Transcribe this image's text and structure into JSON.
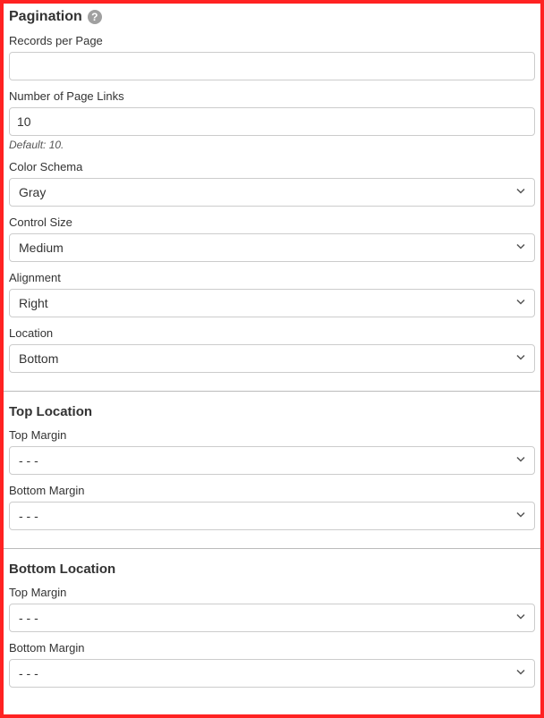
{
  "pagination": {
    "title": "Pagination",
    "records_per_page": {
      "label": "Records per Page",
      "value": ""
    },
    "page_links": {
      "label": "Number of Page Links",
      "value": "10",
      "hint": "Default: 10."
    },
    "color_schema": {
      "label": "Color Schema",
      "value": "Gray"
    },
    "control_size": {
      "label": "Control Size",
      "value": "Medium"
    },
    "alignment": {
      "label": "Alignment",
      "value": "Right"
    },
    "location": {
      "label": "Location",
      "value": "Bottom"
    }
  },
  "top_location": {
    "title": "Top Location",
    "top_margin": {
      "label": "Top Margin",
      "value": "- - -"
    },
    "bottom_margin": {
      "label": "Bottom Margin",
      "value": "- - -"
    }
  },
  "bottom_location": {
    "title": "Bottom Location",
    "top_margin": {
      "label": "Top Margin",
      "value": "- - -"
    },
    "bottom_margin": {
      "label": "Bottom Margin",
      "value": "- - -"
    }
  }
}
